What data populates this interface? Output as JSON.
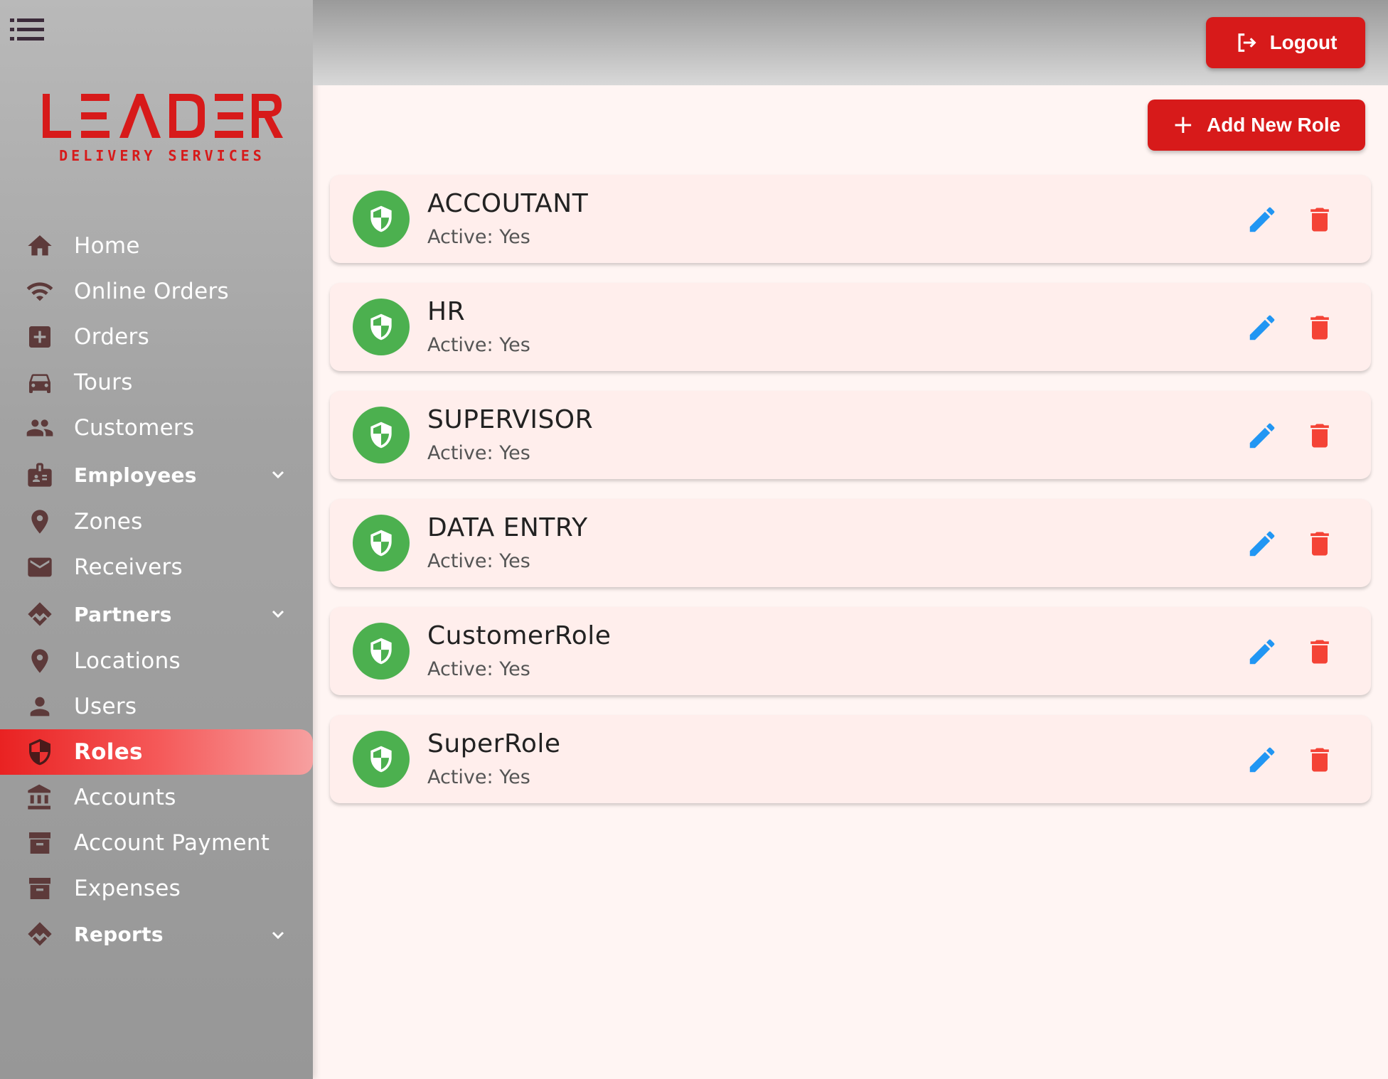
{
  "brand": {
    "logo_main": "LEADER",
    "logo_sub": "DELIVERY SERVICES",
    "accent": "#d71a1a"
  },
  "header": {
    "logout_label": "Logout"
  },
  "sidebar": {
    "items": [
      {
        "label": "Home",
        "icon": "home-icon"
      },
      {
        "label": "Online Orders",
        "icon": "wifi-icon"
      },
      {
        "label": "Orders",
        "icon": "plus-box-icon"
      },
      {
        "label": "Tours",
        "icon": "car-icon"
      },
      {
        "label": "Customers",
        "icon": "people-icon"
      },
      {
        "label": "Employees",
        "icon": "badge-icon",
        "expandable": true
      },
      {
        "label": "Zones",
        "icon": "location-pin-icon"
      },
      {
        "label": "Receivers",
        "icon": "mail-icon"
      },
      {
        "label": "Partners",
        "icon": "handshake-icon",
        "expandable": true
      },
      {
        "label": "Locations",
        "icon": "location-pin-icon"
      },
      {
        "label": "Users",
        "icon": "person-icon"
      },
      {
        "label": "Roles",
        "icon": "shield-icon",
        "active": true
      },
      {
        "label": "Accounts",
        "icon": "bank-icon"
      },
      {
        "label": "Account Payment",
        "icon": "archive-icon"
      },
      {
        "label": "Expenses",
        "icon": "archive-icon"
      },
      {
        "label": "Reports",
        "icon": "handshake-icon",
        "expandable": true
      }
    ]
  },
  "main": {
    "add_label": "Add New Role",
    "roles": [
      {
        "name": "ACCOUTANT",
        "status": "Active: Yes"
      },
      {
        "name": "HR",
        "status": "Active: Yes"
      },
      {
        "name": "SUPERVISOR",
        "status": "Active: Yes"
      },
      {
        "name": "DATA ENTRY",
        "status": "Active: Yes"
      },
      {
        "name": "CustomerRole",
        "status": "Active: Yes"
      },
      {
        "name": "SuperRole",
        "status": "Active: Yes"
      }
    ]
  },
  "colors": {
    "role_icon_bg": "#4cb04f",
    "edit": "#2196f3",
    "delete": "#f44336"
  }
}
